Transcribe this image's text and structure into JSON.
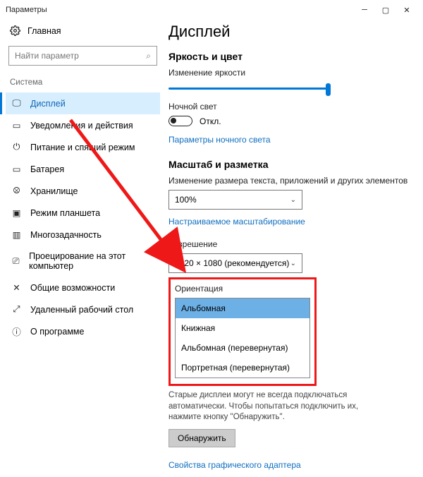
{
  "window": {
    "title": "Параметры"
  },
  "sidebar": {
    "home": "Главная",
    "search_placeholder": "Найти параметр",
    "section": "Система",
    "items": [
      {
        "label": "Дисплей"
      },
      {
        "label": "Уведомления и действия"
      },
      {
        "label": "Питание и спящий режим"
      },
      {
        "label": "Батарея"
      },
      {
        "label": "Хранилище"
      },
      {
        "label": "Режим планшета"
      },
      {
        "label": "Многозадачность"
      },
      {
        "label": "Проецирование на этот компьютер"
      },
      {
        "label": "Общие возможности"
      },
      {
        "label": "Удаленный рабочий стол"
      },
      {
        "label": "О программе"
      }
    ]
  },
  "main": {
    "title": "Дисплей",
    "brightness_heading": "Яркость и цвет",
    "brightness_label": "Изменение яркости",
    "night_label": "Ночной свет",
    "night_state": "Откл.",
    "night_link": "Параметры ночного света",
    "scale_heading": "Масштаб и разметка",
    "scale_label": "Изменение размера текста, приложений и других элементов",
    "scale_value": "100%",
    "custom_scale_link": "Настраиваемое масштабирование",
    "resolution_label": "Разрешение",
    "resolution_value": "1920 × 1080 (рекомендуется)",
    "orientation_label": "Ориентация",
    "orientation_options": [
      "Альбомная",
      "Книжная",
      "Альбомная (перевернутая)",
      "Портретная (перевернутая)"
    ],
    "detect_hint": "Старые дисплеи могут не всегда подключаться автоматически. Чтобы попытаться подключить их, нажмите кнопку \"Обнаружить\".",
    "detect_button": "Обнаружить",
    "adapter_link": "Свойства графического адаптера"
  }
}
